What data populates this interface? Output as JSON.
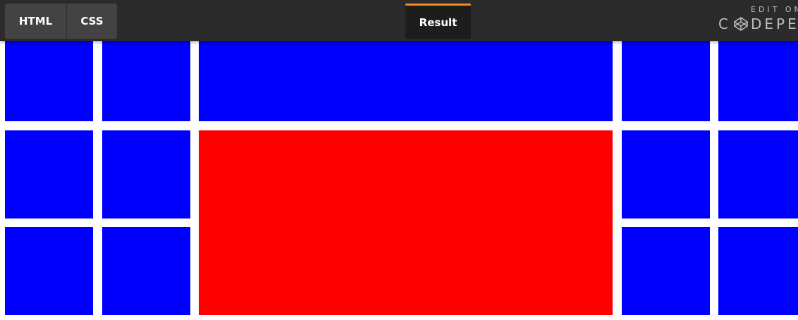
{
  "tabs": {
    "html_label": "HTML",
    "css_label": "CSS",
    "result_label": "Result"
  },
  "codepen": {
    "edit_on": "EDIT ON",
    "brand_before": "C",
    "brand_after": "DEPEN",
    "logo_icon": "codepen-logo-icon"
  },
  "colors": {
    "topbar": "#2b2b2b",
    "tab": "#434343",
    "active_tab": "#1d1d1d",
    "accent": "#f18a1f",
    "tile_blue": "#0000ff",
    "tile_red": "#ff0000"
  },
  "grid": {
    "rows": 3,
    "highlight": "red"
  }
}
